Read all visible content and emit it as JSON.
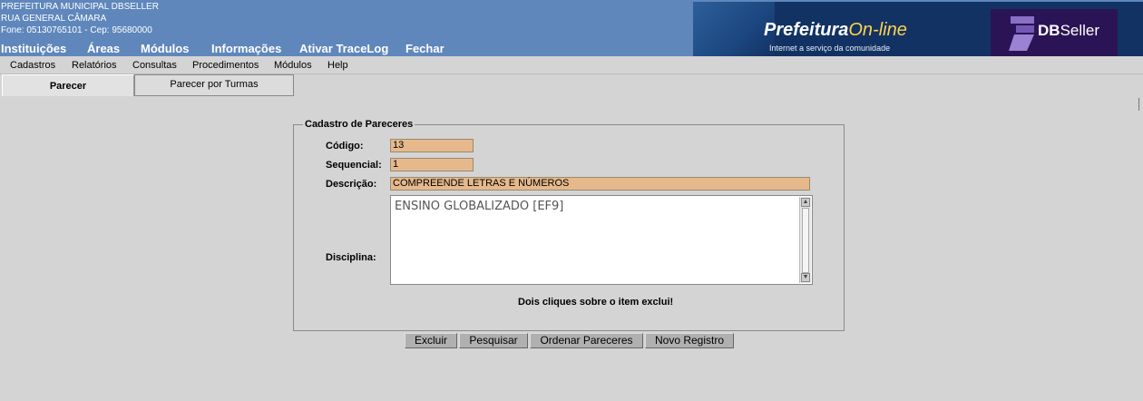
{
  "header": {
    "org_name": "PREFEITURA MUNICIPAL DBSELLER",
    "address": "RUA GENERAL CÂMARA",
    "contact": "Fone: 05130765101  -  Cep: 95680000",
    "main_menu": [
      "Instituições",
      "Áreas",
      "Módulos",
      "Informações",
      "Ativar TraceLog",
      "Fechar"
    ],
    "brand_main": "Prefeitura",
    "brand_accent": "On-line",
    "brand_sub": "Internet a serviço da comunidade",
    "db_logo_bold": "DB",
    "db_logo_text": "Seller"
  },
  "sub_menu": [
    "Cadastros",
    "Relatórios",
    "Consultas",
    "Procedimentos",
    "Módulos",
    "Help"
  ],
  "tabs": [
    {
      "label": "Parecer",
      "active": true
    },
    {
      "label": "Parecer por Turmas",
      "active": false
    }
  ],
  "form": {
    "legend": "Cadastro de Pareceres",
    "codigo_label": "Código:",
    "codigo_value": "13",
    "sequencial_label": "Sequencial:",
    "sequencial_value": "1",
    "descricao_label": "Descrição:",
    "descricao_value": "COMPREENDE LETRAS E NÚMEROS",
    "disciplina_label": "Disciplina:",
    "disciplina_items": [
      "ENSINO GLOBALIZADO [EF9]"
    ],
    "hint": "Dois cliques sobre o item exclui!"
  },
  "buttons": {
    "excluir": "Excluir",
    "pesquisar": "Pesquisar",
    "ordenar": "Ordenar Pareceres",
    "novo": "Novo Registro"
  },
  "colors": {
    "header_bg": "#5f87bc",
    "page_bg": "#d4d4d4",
    "input_bg": "#e6b98c",
    "banner_bg": "#123264",
    "brand_accent": "#ffd24a"
  }
}
